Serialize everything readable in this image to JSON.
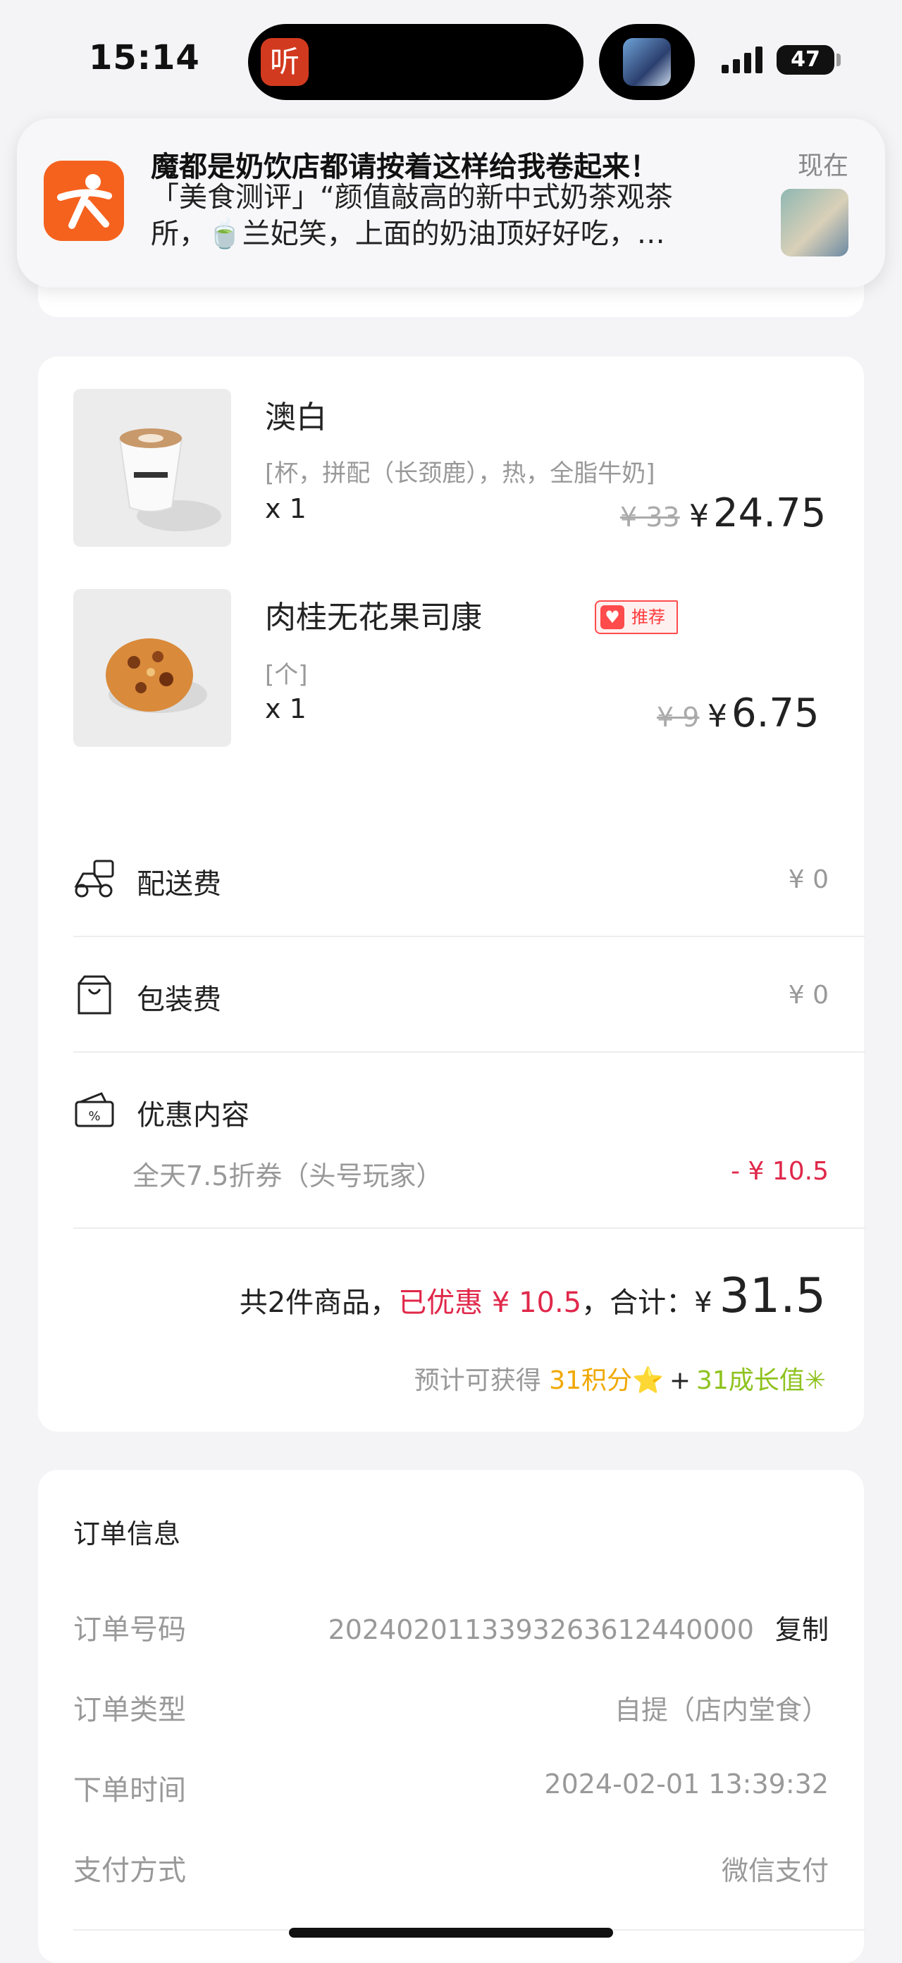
{
  "status_bar": {
    "time": "15:14",
    "island_app_glyph": "听",
    "battery": "47"
  },
  "notification": {
    "title": "魔都是奶饮店都请按着这样给我卷起来！",
    "time": "现在",
    "line1": "「美食测评」“颜值敲高的新中式奶茶观茶",
    "line2": "所，🍵兰妃笑，上面的奶油顶好好吃，…",
    "app_icon": "dianping-icon"
  },
  "items": [
    {
      "name": "澳白",
      "spec": "[杯，拼配（长颈鹿），热，全脂牛奶]",
      "qty": "x 1",
      "old_price": "¥ 33",
      "price_yen": "¥",
      "price": "24.75"
    },
    {
      "name": "肉桂无花果司康",
      "spec": "[个]",
      "qty": "x 1",
      "old_price": "¥ 9",
      "price_yen": "¥",
      "price": "6.75",
      "badge": "推荐"
    }
  ],
  "fees": {
    "delivery_label": "配送费",
    "delivery_value": "¥ 0",
    "packing_label": "包装费",
    "packing_value": "¥ 0",
    "discount_label": "优惠内容",
    "discount_name": "全天7.5折券（头号玩家）",
    "discount_value": "- ¥ 10.5"
  },
  "summary": {
    "count_text": "共2件商品，",
    "saved_text": "已优惠 ¥ 10.5",
    "total_label": "，合计：",
    "total_yen": "¥",
    "total": "31.5",
    "points_prefix": "预计可获得",
    "points": "31积分",
    "points_icon": "⭐",
    "plus": "+",
    "growth": "31成长值",
    "growth_icon": "✳"
  },
  "order_info": {
    "title": "订单信息",
    "order_no_label": "订单号码",
    "order_no": "2024020113393263612440000",
    "copy_label": "复制",
    "type_label": "订单类型",
    "type_value": "自提（店内堂食）",
    "time_label": "下单时间",
    "time_value": "2024-02-01 13:39:32",
    "pay_label": "支付方式",
    "pay_value": "微信支付"
  },
  "colors": {
    "accent_red": "#e0284a",
    "points_gold": "#f0a800",
    "growth_green": "#8fc31f",
    "brand_orange": "#f5621e"
  }
}
